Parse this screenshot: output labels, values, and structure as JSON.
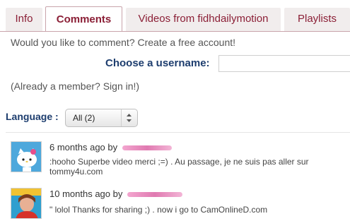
{
  "tabs": [
    {
      "label": "Info"
    },
    {
      "label": "Comments"
    },
    {
      "label": "Videos from fidhdailymotion"
    },
    {
      "label": "Playlists"
    }
  ],
  "comment_prompt": "Would you like to comment? Create a free account!",
  "username_label": "Choose a username:",
  "member_link": "(Already a member? Sign in!)",
  "language": {
    "label": "Language :",
    "selected": "All (2)"
  },
  "comments": [
    {
      "time": "6 months ago by",
      "text": ":hooho Superbe video merci ;=) . Au passage, je ne suis pas aller sur",
      "text2": "tommy4u.com"
    },
    {
      "time": "10 months ago by",
      "text": "\" lolol Thanks for sharing ;) . now i go to CamOnlineD.com"
    }
  ],
  "colors": {
    "tab_text": "#8b1f36",
    "label": "#1d3d6e",
    "blurred_name": "#e07ab1"
  }
}
